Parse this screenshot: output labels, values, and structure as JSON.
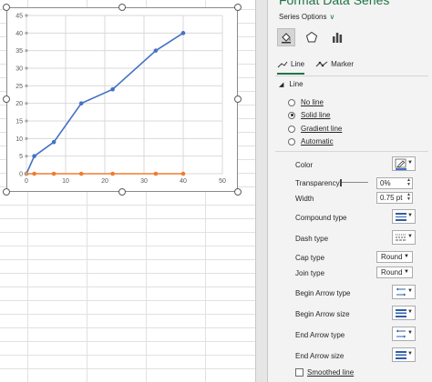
{
  "chart_data": {
    "type": "scatter",
    "series": [
      {
        "name": "",
        "color": "#4472c4",
        "x": [
          0,
          2,
          7,
          14,
          22,
          33,
          40
        ],
        "y": [
          0,
          5,
          9,
          20,
          24,
          35,
          40
        ]
      },
      {
        "name": "",
        "color": "#ed7d31",
        "x": [
          0,
          2,
          7,
          14,
          22,
          33,
          40
        ],
        "y": [
          0,
          0,
          0,
          0,
          0,
          0,
          0
        ]
      }
    ],
    "xlim": [
      0,
      50
    ],
    "ylim": [
      0,
      45
    ],
    "x_ticks": [
      "0",
      "10",
      "20",
      "30",
      "40",
      "50"
    ],
    "y_ticks": [
      "0",
      "5",
      "10",
      "15",
      "20",
      "25",
      "30",
      "35",
      "40",
      "45"
    ],
    "grid": true,
    "title": "",
    "xlabel": "",
    "ylabel": ""
  },
  "pane": {
    "title": "Format Data Series",
    "series_options_label": "Series Options",
    "category_icons": [
      "fill-line-icon",
      "effects-pentagon-icon",
      "series-options-bars-icon"
    ],
    "tabs": [
      {
        "label": "Line",
        "icon": "line-icon"
      },
      {
        "label": "Marker",
        "icon": "marker-icon"
      }
    ],
    "section_title": "Line",
    "radio_options": [
      {
        "label": "No line",
        "checked": false
      },
      {
        "label": "Solid line",
        "checked": true
      },
      {
        "label": "Gradient line",
        "checked": false
      },
      {
        "label": "Automatic",
        "checked": false
      }
    ],
    "props": {
      "color_label": "Color",
      "transparency_label": "Transparency",
      "transparency_value": "0%",
      "width_label": "Width",
      "width_value": "0.75 pt",
      "compound_type_label": "Compound type",
      "dash_type_label": "Dash type",
      "cap_type_label": "Cap type",
      "cap_type_value": "Round",
      "join_type_label": "Join type",
      "join_type_value": "Round",
      "begin_arrow_type_label": "Begin Arrow type",
      "begin_arrow_size_label": "Begin Arrow size",
      "end_arrow_type_label": "End Arrow type",
      "end_arrow_size_label": "End Arrow size",
      "smoothed_line_label": "Smoothed line"
    },
    "accent_color": "#217346",
    "series_line_color": "#4472c4"
  }
}
